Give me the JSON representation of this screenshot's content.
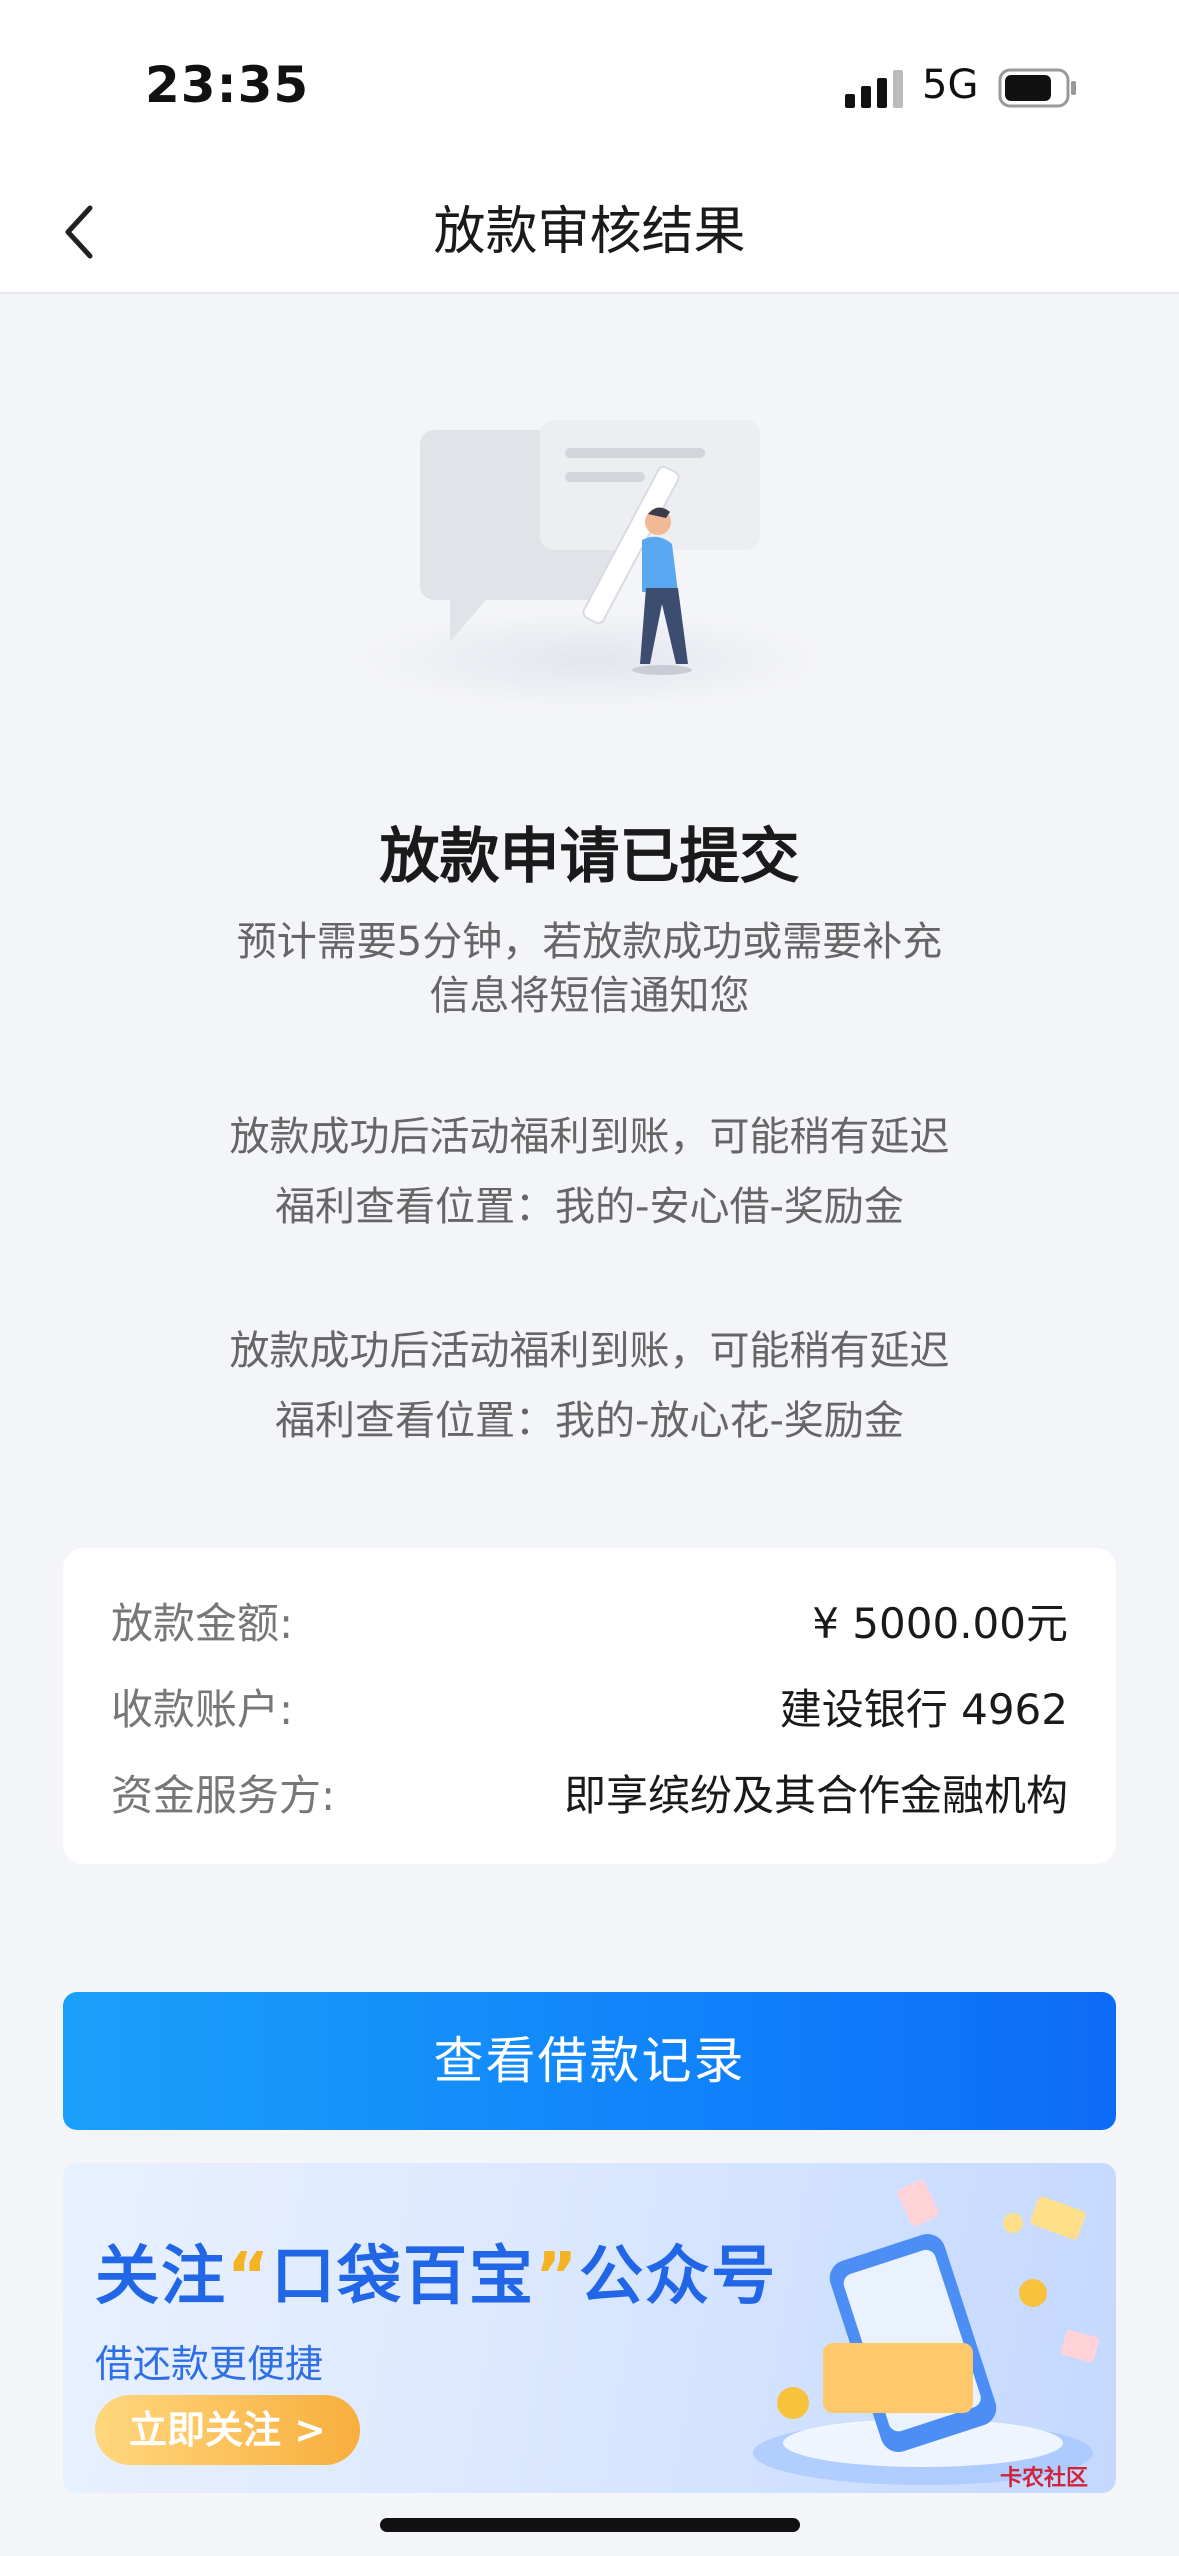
{
  "status_bar": {
    "time": "23:35",
    "network": "5G"
  },
  "nav": {
    "title": "放款审核结果"
  },
  "result": {
    "headline": "放款申请已提交",
    "sub1": "预计需要5分钟，若放款成功或需要补充",
    "sub1b": "信息将短信通知您",
    "sub2a": "放款成功后活动福利到账，可能稍有延迟",
    "sub2b": "福利查看位置：我的-安心借-奖励金",
    "sub3a": "放款成功后活动福利到账，可能稍有延迟",
    "sub3b": "福利查看位置：我的-放心花-奖励金"
  },
  "info": {
    "amount_label": "放款金额:",
    "amount_value": "¥ 5000.00元",
    "account_label": "收款账户:",
    "account_value": "建设银行 4962",
    "provider_label": "资金服务方:",
    "provider_value": "即享缤纷及其合作金融机构"
  },
  "primary_button": "查看借款记录",
  "banner": {
    "title_pre": "关注",
    "title_quote_open": "“",
    "title_name": "口袋百宝",
    "title_quote_close": "”",
    "title_post": "公众号",
    "subtitle": "借还款更便捷",
    "button": "立即关注 >"
  },
  "watermark": "卡农社区",
  "colors": {
    "primary": "#1185fa",
    "banner_title": "#2266e8",
    "accent": "#f5b324"
  }
}
